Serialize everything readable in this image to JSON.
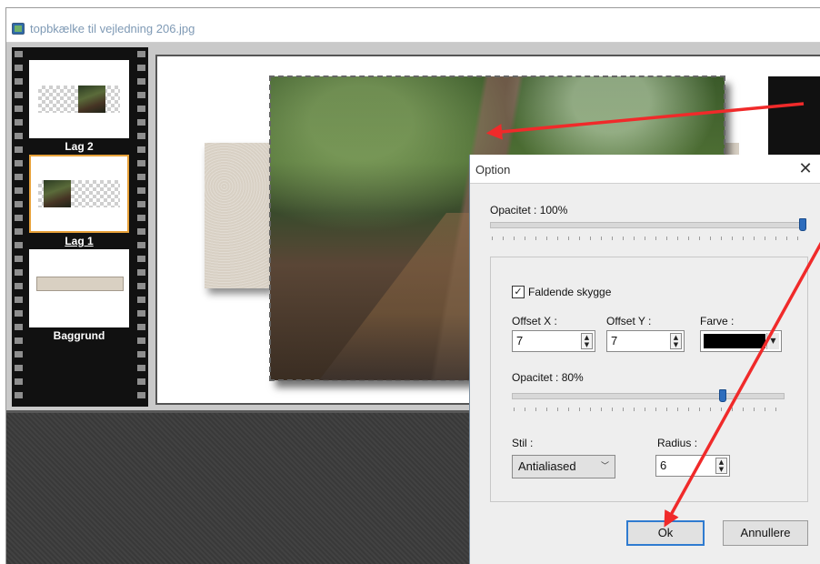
{
  "window": {
    "title": "topbkælke til vejledning 206.jpg",
    "icon": "image-file-icon"
  },
  "layers": [
    {
      "label": "Lag 2",
      "selected": false
    },
    {
      "label": "Lag 1",
      "selected": true
    },
    {
      "label": "Baggrund",
      "selected": false
    }
  ],
  "dialog": {
    "title": "Option",
    "close_glyph": "✕",
    "opacity_main": {
      "label": "Opacitet : 100%",
      "value": 100
    },
    "drop_shadow": {
      "checkbox_label": "Faldende skygge",
      "checked": true,
      "offset_x": {
        "label": "Offset X :",
        "value": "7"
      },
      "offset_y": {
        "label": "Offset Y :",
        "value": "7"
      },
      "color": {
        "label": "Farve :",
        "value": "#000000"
      },
      "opacity": {
        "label": "Opacitet : 80%",
        "value": 80
      },
      "style": {
        "label": "Stil :",
        "value": "Antialiased"
      },
      "radius": {
        "label": "Radius :",
        "value": "6"
      }
    },
    "ok_label": "Ok",
    "cancel_label": "Annullere"
  },
  "colors": {
    "annotation_arrow": "#f02a2a",
    "selected_layer_border": "#e8a23a",
    "slider_thumb": "#2e6dbd",
    "ok_focus_border": "#2f7bd0"
  }
}
